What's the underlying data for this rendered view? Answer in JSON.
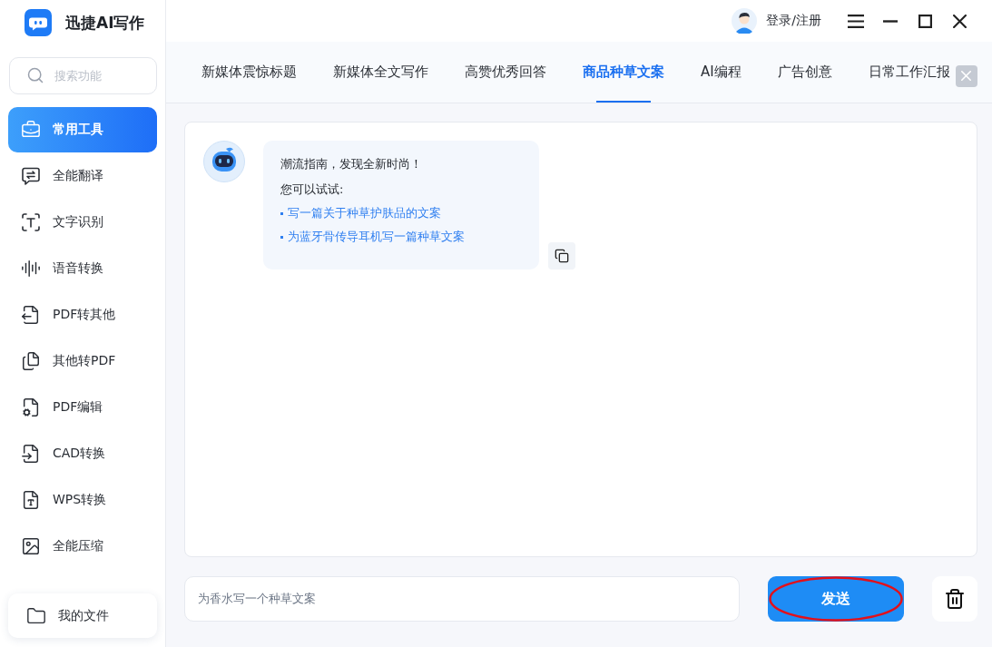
{
  "app": {
    "title": "迅捷AI写作"
  },
  "search": {
    "placeholder": "搜索功能"
  },
  "sidebar": {
    "items": [
      {
        "label": "常用工具",
        "selected": true
      },
      {
        "label": "全能翻译",
        "selected": false
      },
      {
        "label": "文字识别",
        "selected": false
      },
      {
        "label": "语音转换",
        "selected": false
      },
      {
        "label": "PDF转其他",
        "selected": false
      },
      {
        "label": "其他转PDF",
        "selected": false
      },
      {
        "label": "PDF编辑",
        "selected": false
      },
      {
        "label": "CAD转换",
        "selected": false
      },
      {
        "label": "WPS转换",
        "selected": false
      },
      {
        "label": "全能压缩",
        "selected": false
      }
    ]
  },
  "my_files": {
    "label": "我的文件"
  },
  "account": {
    "label": "登录/注册"
  },
  "tabs": [
    {
      "label": "新媒体震惊标题",
      "selected": false
    },
    {
      "label": "新媒体全文写作",
      "selected": false
    },
    {
      "label": "高赞优秀回答",
      "selected": false
    },
    {
      "label": "商品种草文案",
      "selected": true
    },
    {
      "label": "AI编程",
      "selected": false
    },
    {
      "label": "广告创意",
      "selected": false
    },
    {
      "label": "日常工作汇报",
      "selected": false
    }
  ],
  "chat": {
    "bot_message": {
      "title": "潮流指南，发现全新时尚！",
      "prompt": "您可以试试:",
      "suggestions": [
        "写一篇关于种草护肤品的文案",
        "为蓝牙骨传导耳机写一篇种草文案"
      ]
    }
  },
  "composer": {
    "value": "为香水写一个种草文案"
  },
  "send_button": {
    "label": "发送",
    "circled": true
  }
}
